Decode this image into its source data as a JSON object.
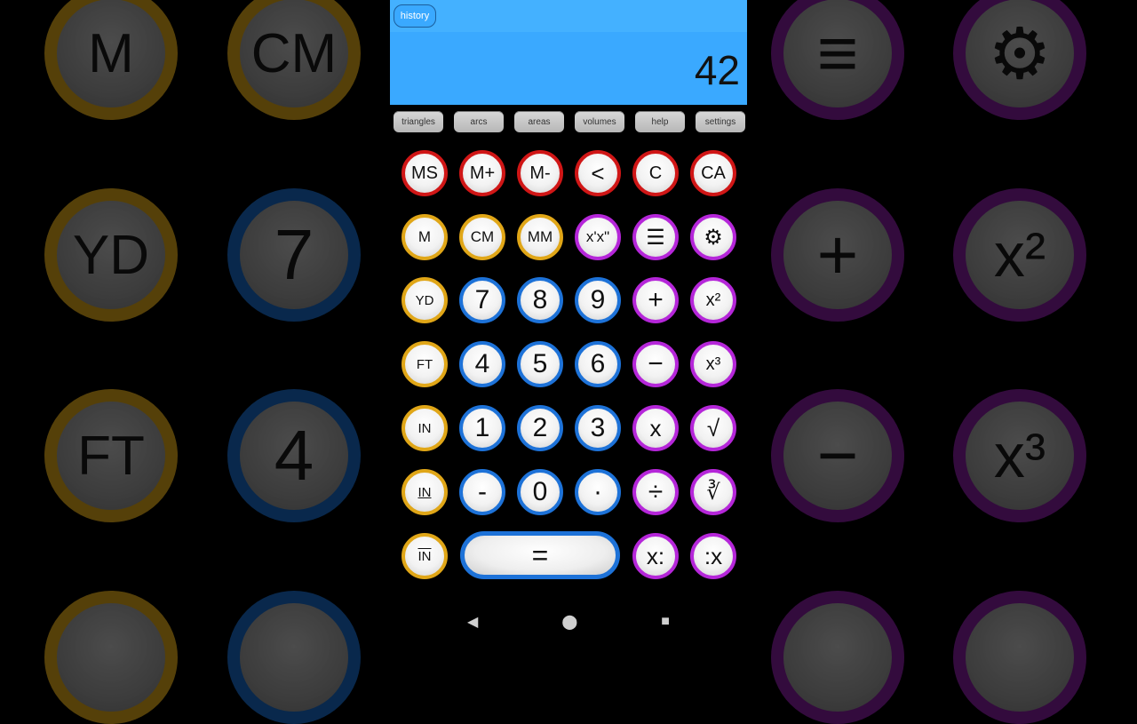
{
  "background": {
    "left": [
      "M",
      "CM",
      "YD",
      "7",
      "FT",
      "4"
    ],
    "right": [
      "≡",
      "⚙",
      "+",
      "x²",
      "−",
      "x³"
    ]
  },
  "display": {
    "history_label": "history",
    "value": "42"
  },
  "tabs": [
    "triangles",
    "arcs",
    "areas",
    "volumes",
    "help",
    "settings"
  ],
  "keys": {
    "row1": [
      "MS",
      "M+",
      "M-",
      "<",
      "C",
      "CA"
    ],
    "row2": [
      "M",
      "CM",
      "MM",
      "x'x\"",
      "☰",
      "⚙"
    ],
    "row3": [
      "YD",
      "7",
      "8",
      "9",
      "+",
      "x²"
    ],
    "row4": [
      "FT",
      "4",
      "5",
      "6",
      "−",
      "x³"
    ],
    "row5": [
      "IN",
      "1",
      "2",
      "3",
      "x",
      "√"
    ],
    "row6": [
      "IN",
      "-",
      "0",
      "·",
      "÷",
      "∛"
    ],
    "row7": [
      "IN",
      "=",
      "x:",
      ":x"
    ]
  },
  "nav": [
    "◀",
    "⬤",
    "■"
  ]
}
